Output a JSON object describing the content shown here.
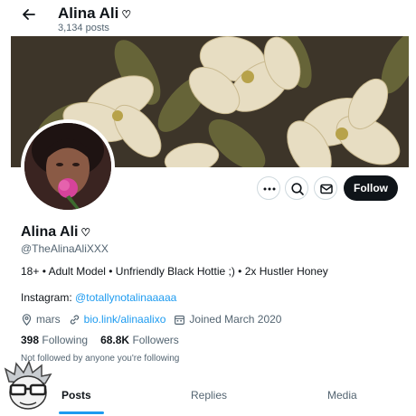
{
  "header": {
    "back_icon": "arrow-left-icon",
    "name": "Alina Ali",
    "badge_glyph": "♡",
    "posts_count": "3,134 posts"
  },
  "banner": {
    "description_icon": "magnolia-banner"
  },
  "profile": {
    "name": "Alina Ali",
    "badge_glyph": "♡",
    "handle": "@TheAlinaAliXXX",
    "bio": "18+ • Adult Model • Unfriendly Black Hottie ;) • 2x Hustler Honey",
    "instagram_label": "Instagram:",
    "instagram_handle": "@totallynotalinaaaaa",
    "location": "mars",
    "website": "bio.link/alinaalixo",
    "joined": "Joined March 2020",
    "following_count": "398",
    "following_label": "Following",
    "followers_count": "68.8K",
    "followers_label": "Followers",
    "not_followed_text": "Not followed by anyone you're following"
  },
  "actions": {
    "more_icon": "more-horizontal-icon",
    "search_icon": "search-icon",
    "message_icon": "envelope-icon",
    "follow_label": "Follow"
  },
  "tabs": [
    {
      "label": "Posts",
      "active": true
    },
    {
      "label": "Replies",
      "active": false
    },
    {
      "label": "Media",
      "active": false
    }
  ],
  "colors": {
    "accent": "#1d9bf0",
    "text": "#0f1419",
    "secondary_text": "#536471",
    "follow_button": "#0f1419"
  }
}
